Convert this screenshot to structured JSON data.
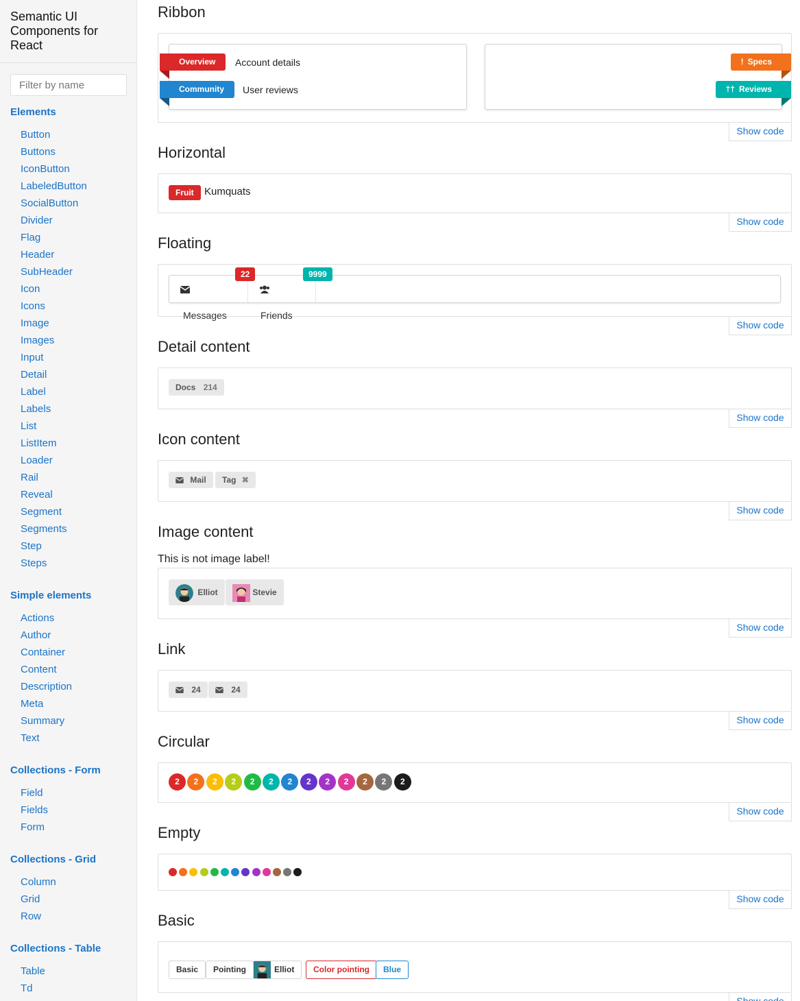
{
  "sidebar": {
    "title": "Semantic UI Components for React",
    "filter_placeholder": "Filter by name",
    "groups": [
      {
        "heading": "Elements",
        "items": [
          "Button",
          "Buttons",
          "IconButton",
          "LabeledButton",
          "SocialButton",
          "Divider",
          "Flag",
          "Header",
          "SubHeader",
          "Icon",
          "Icons",
          "Image",
          "Images",
          "Input",
          "Detail",
          "Label",
          "Labels",
          "List",
          "ListItem",
          "Loader",
          "Rail",
          "Reveal",
          "Segment",
          "Segments",
          "Step",
          "Steps"
        ]
      },
      {
        "heading": "Simple elements",
        "items": [
          "Actions",
          "Author",
          "Container",
          "Content",
          "Description",
          "Meta",
          "Summary",
          "Text"
        ]
      },
      {
        "heading": "Collections - Form",
        "items": [
          "Field",
          "Fields",
          "Form"
        ]
      },
      {
        "heading": "Collections - Grid",
        "items": [
          "Column",
          "Grid",
          "Row"
        ]
      },
      {
        "heading": "Collections - Table",
        "items": [
          "Table",
          "Td"
        ]
      }
    ]
  },
  "show_code": "Show code",
  "sections": {
    "ribbon": {
      "title": "Ribbon",
      "left": [
        {
          "label": "Overview",
          "text": "Account details",
          "color": "#db2828"
        },
        {
          "label": "Community",
          "text": "User reviews",
          "color": "#2185d0"
        }
      ],
      "right": [
        {
          "label": "Specs",
          "icon": "info-icon",
          "color": "#f2711c"
        },
        {
          "label": "Reviews",
          "icon": "restaurant-icon",
          "color": "#00b5ad"
        }
      ]
    },
    "horizontal": {
      "title": "Horizontal",
      "label": "Fruit",
      "text": "Kumquats",
      "color": "#db2828"
    },
    "floating": {
      "title": "Floating",
      "items": [
        {
          "text": "Messages",
          "icon": "mail-icon",
          "count": "22",
          "color": "#db2828"
        },
        {
          "text": "Friends",
          "icon": "users-icon",
          "count": "9999",
          "color": "#00b5ad"
        }
      ]
    },
    "detail": {
      "title": "Detail content",
      "label": "Docs",
      "detail": "214"
    },
    "icon_content": {
      "title": "Icon content",
      "mail": "Mail",
      "tag": "Tag"
    },
    "image_content": {
      "title": "Image content",
      "note": "This is not image label!",
      "people": [
        "Elliot",
        "Stevie"
      ]
    },
    "link": {
      "title": "Link",
      "counts": [
        "24",
        "24"
      ]
    },
    "circular": {
      "title": "Circular",
      "value": "2",
      "colors": [
        "#db2828",
        "#f2711c",
        "#fbbd08",
        "#b5cc18",
        "#21ba45",
        "#00b5ad",
        "#2185d0",
        "#6435c9",
        "#a333c8",
        "#e03997",
        "#a5673f",
        "#767676",
        "#1b1c1d"
      ]
    },
    "empty": {
      "title": "Empty"
    },
    "basic": {
      "title": "Basic",
      "labels": [
        "Basic",
        "Pointing",
        "Elliot",
        "Color pointing",
        "Blue"
      ],
      "red": "#db2828",
      "blue": "#2185d0"
    }
  }
}
